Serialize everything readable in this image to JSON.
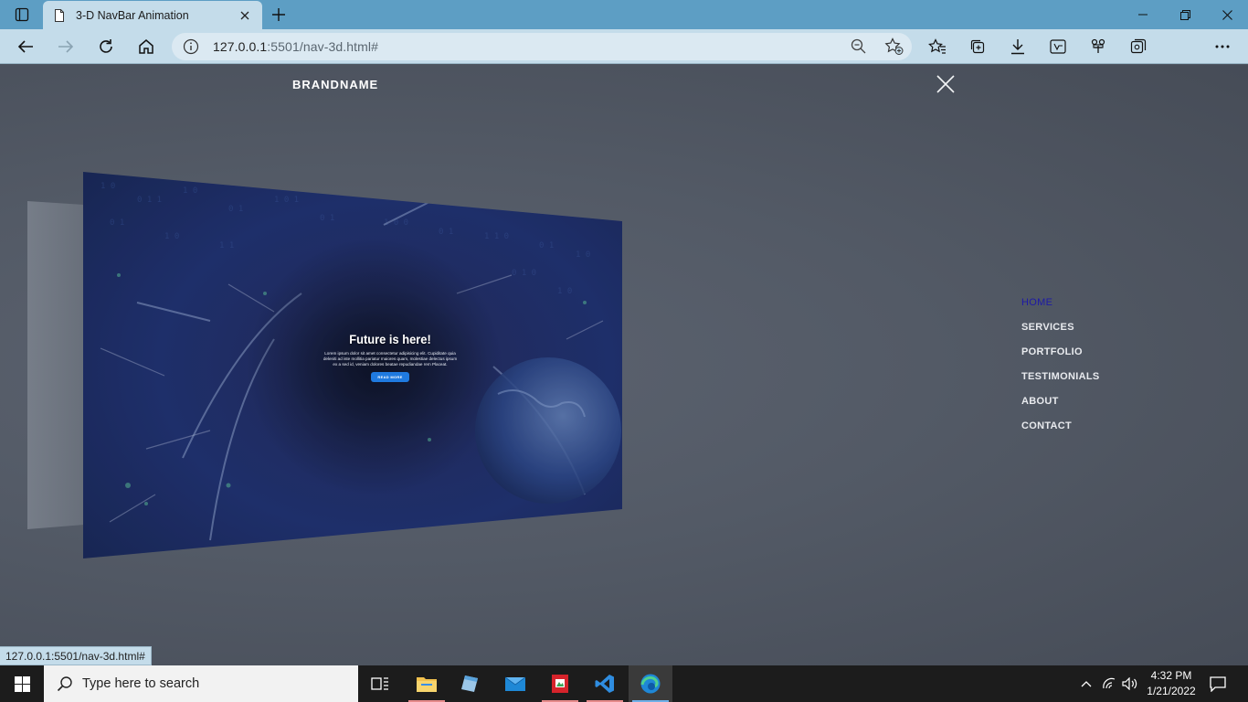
{
  "browser": {
    "tab_title": "3-D NavBar Animation",
    "url_host": "127.0.0.1",
    "url_path": ":5501/nav-3d.html#",
    "status_url": "127.0.0.1:5501/nav-3d.html#"
  },
  "page": {
    "brand": "BRANDNAME",
    "hero": {
      "title": "Future is here!",
      "text": "Lorem ipsum dolor sit amet consectetur adipisicing elit. Cupiditate quia deleniti ad iste mollitia pariatur maiores quam, molestiae delectus ipsum ex a sed id, veniam dolores beatae repudiandae rem Placeat.",
      "button": "READ MORE"
    },
    "nav": [
      "HOME",
      "SERVICES",
      "PORTFOLIO",
      "TESTIMONIALS",
      "ABOUT",
      "CONTACT"
    ],
    "nav_active": "HOME"
  },
  "taskbar": {
    "search_placeholder": "Type here to search",
    "time": "4:32 PM",
    "date": "1/21/2022"
  },
  "colors": {
    "titlebar": "#5d9ec4",
    "toolbar": "#c4dcea",
    "page_bg": "#535a66",
    "nav_active": "#1d1aa6",
    "hero_button": "#1f7ae0"
  }
}
